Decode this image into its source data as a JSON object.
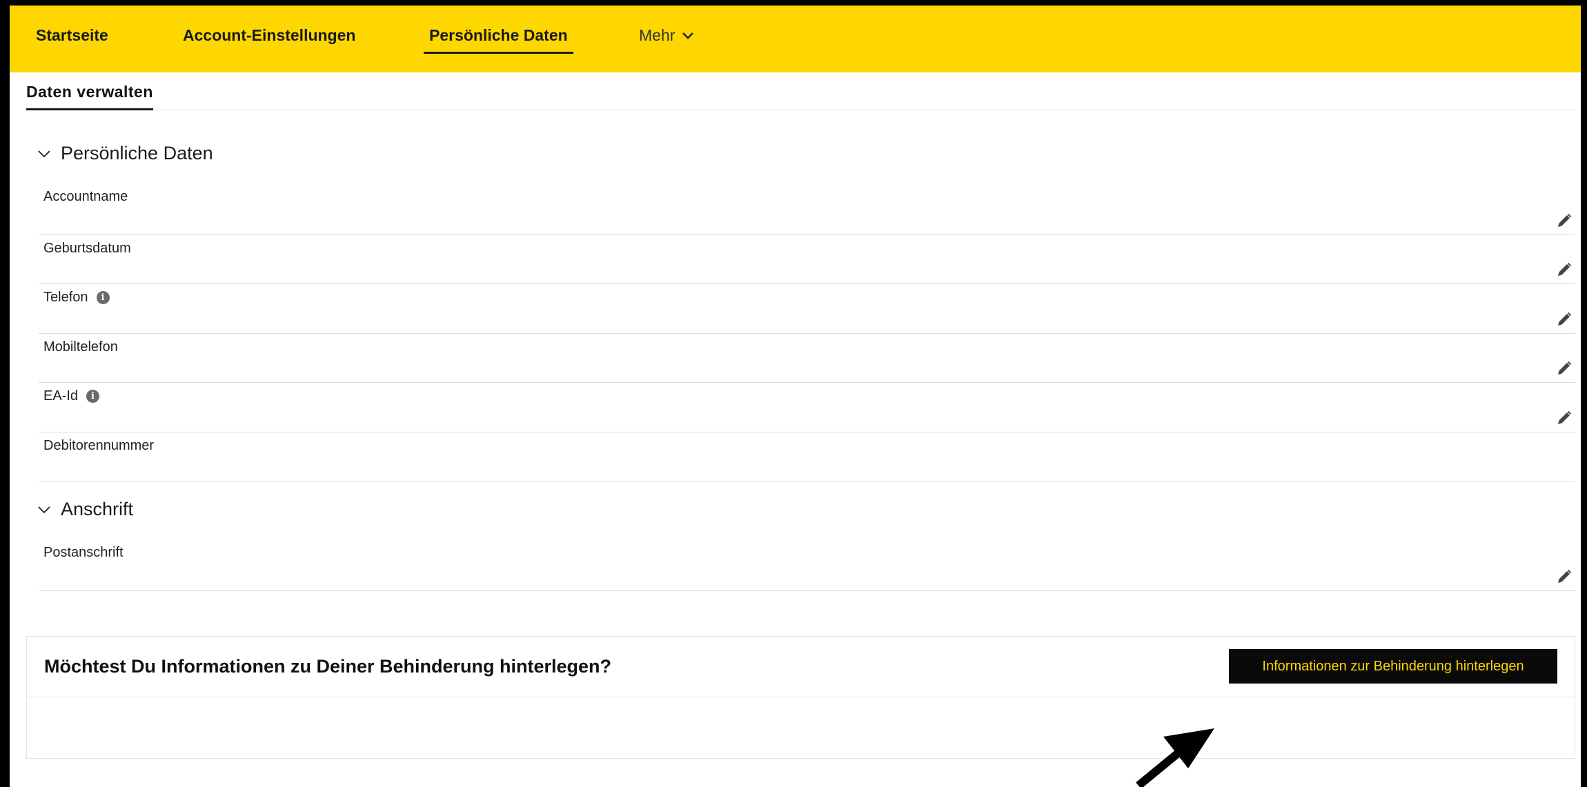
{
  "nav": {
    "items": [
      {
        "label": "Startseite"
      },
      {
        "label": "Account-Einstellungen"
      },
      {
        "label": "Persönliche Daten",
        "active": true
      }
    ],
    "more_label": "Mehr"
  },
  "subtab": {
    "label": "Daten verwalten"
  },
  "personal": {
    "title": "Persönliche Daten",
    "fields": [
      {
        "label": "Accountname",
        "info": false,
        "editable": true
      },
      {
        "label": "Geburtsdatum",
        "info": false,
        "editable": true
      },
      {
        "label": "Telefon",
        "info": true,
        "editable": true
      },
      {
        "label": "Mobiltelefon",
        "info": false,
        "editable": true
      },
      {
        "label": "EA-Id",
        "info": true,
        "editable": true
      },
      {
        "label": "Debitorennummer",
        "info": false,
        "editable": false
      }
    ]
  },
  "address": {
    "title": "Anschrift",
    "fields": [
      {
        "label": "Postanschrift",
        "info": false,
        "editable": true
      }
    ]
  },
  "disability": {
    "question": "Möchtest Du Informationen zu Deiner Behinderung hinterlegen?",
    "button_label": "Informationen zur Behinderung hinterlegen"
  },
  "icons": {
    "chevron": "chevron-down-icon",
    "info": "info-icon",
    "edit": "pencil-icon",
    "arrow": "arrow-annotation-icon"
  },
  "colors": {
    "brand_yellow": "#ffd700",
    "button_bg": "#0a0a0a",
    "button_text": "#ffd700"
  }
}
